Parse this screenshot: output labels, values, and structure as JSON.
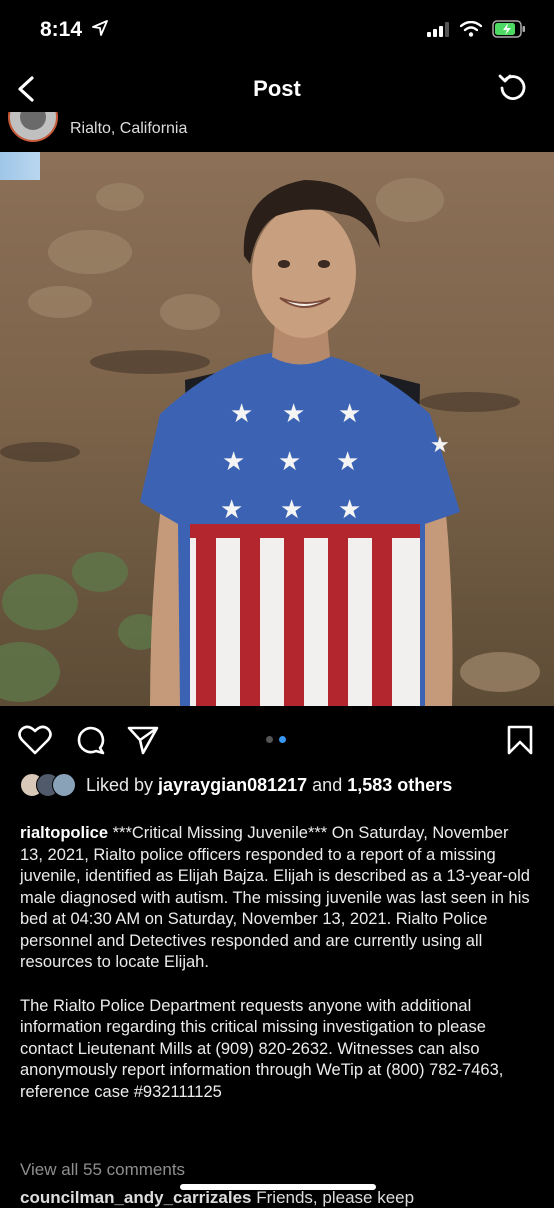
{
  "status_bar": {
    "time": "8:14",
    "battery_color": "#4cd964"
  },
  "nav": {
    "title": "Post",
    "back_icon": "chevron-left-icon",
    "refresh_icon": "refresh-icon"
  },
  "post": {
    "location": "Rialto, California",
    "photo_alt": "",
    "carousel": {
      "count": 2,
      "active_index": 1
    },
    "likes": {
      "prefix": "Liked by ",
      "user": "jayraygian081217",
      "connector": " and ",
      "others": "1,583 others"
    },
    "caption": {
      "username": "rialtopolice",
      "paragraph1": "***Critical Missing Juvenile*** On Saturday, November 13, 2021, Rialto police officers responded to a report of a missing juvenile, identified as Elijah Bajza. Elijah is described as a 13-year-old male diagnosed with autism. The missing juvenile was last seen in his bed at 04:30 AM on Saturday, November 13, 2021. Rialto Police personnel and Detectives responded and are currently using all resources to locate Elijah.",
      "paragraph2": "The Rialto Police Department requests anyone with additional information regarding this critical missing investigation to please contact Lieutenant Mills at (909) 820-2632. Witnesses can also anonymously report information through WeTip at (800) 782-7463, reference case #932111125"
    },
    "view_comments": "View all 55 comments",
    "next_comment": {
      "username": "councilman_andy_carrizales",
      "text": "Friends, please keep"
    }
  },
  "colors": {
    "background": "#000000",
    "accent": "#3897f0",
    "muted": "#8e8e8e"
  }
}
